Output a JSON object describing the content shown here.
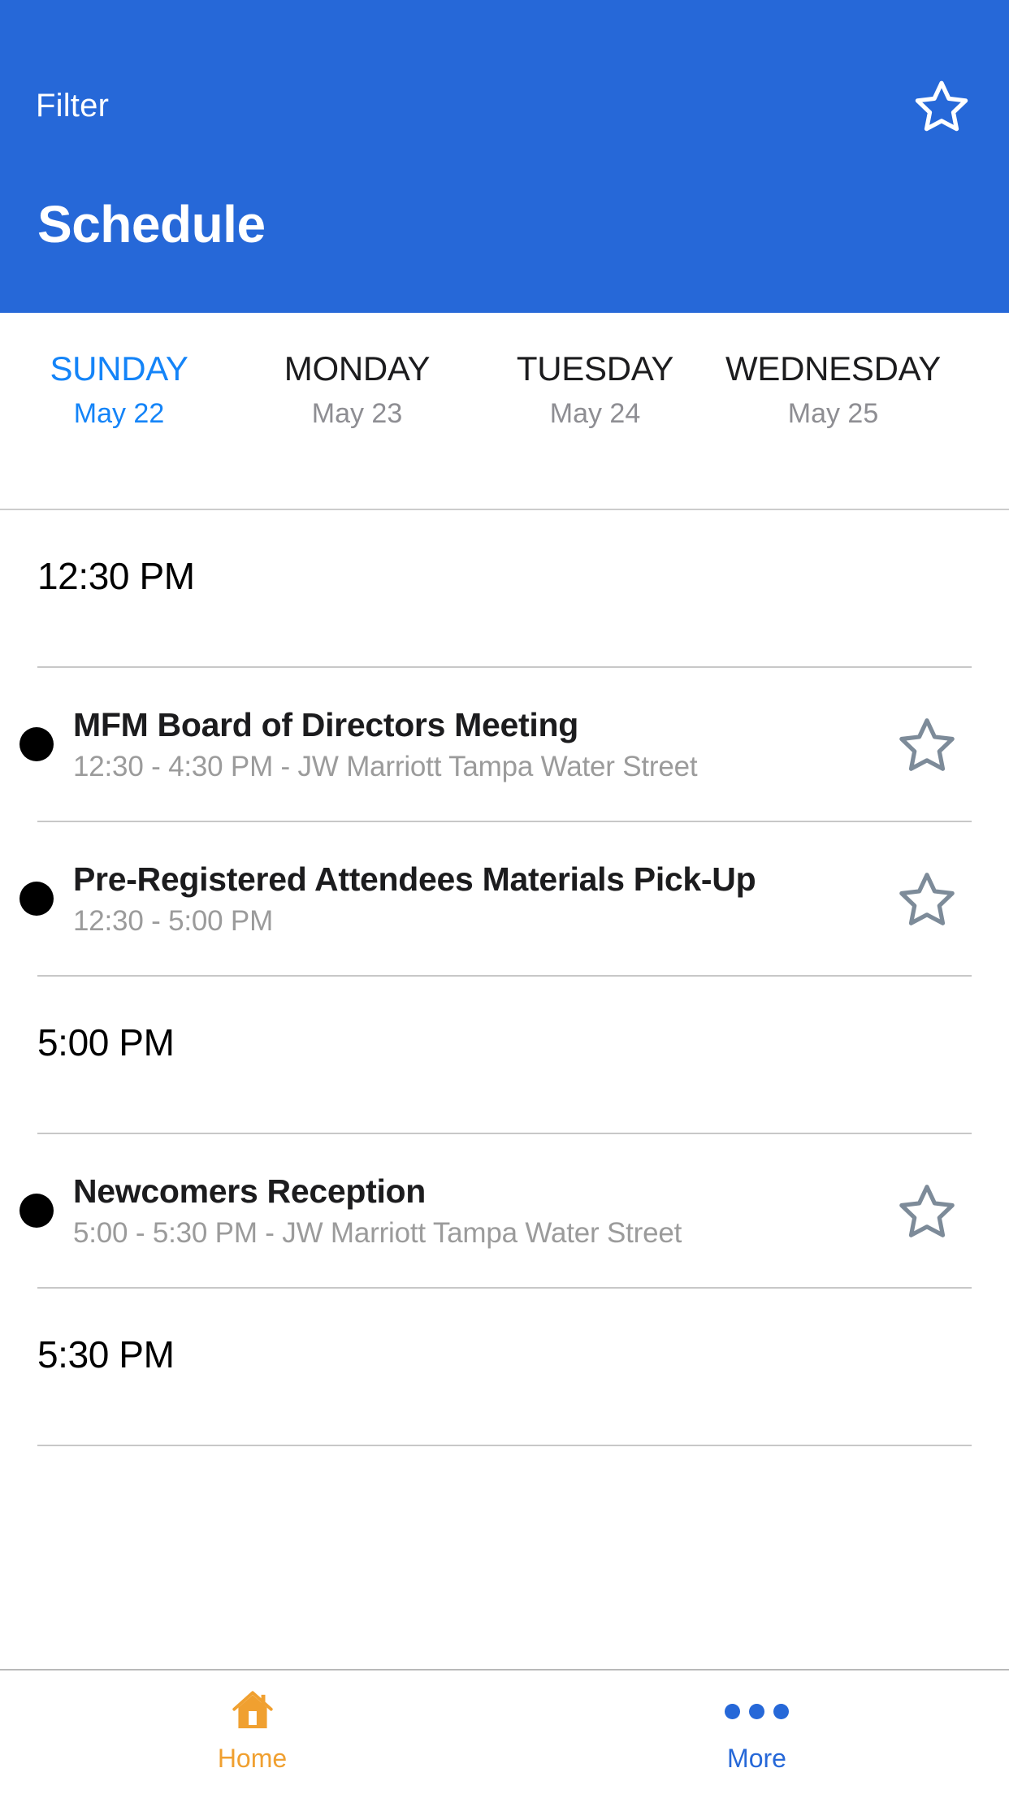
{
  "header": {
    "filter_label": "Filter",
    "title": "Schedule",
    "favorite_icon": "star-outline-icon",
    "background_color": "#2668D8"
  },
  "day_tabs": {
    "active_index": 0,
    "active_color": "#1484F8",
    "items": [
      {
        "day": "SUNDAY",
        "date": "May 22"
      },
      {
        "day": "MONDAY",
        "date": "May 23"
      },
      {
        "day": "TUESDAY",
        "date": "May 24"
      },
      {
        "day": "WEDNESDAY",
        "date": "May 25"
      }
    ]
  },
  "schedule": {
    "groups": [
      {
        "time": "12:30 PM",
        "events": [
          {
            "title": "MFM Board of Directors Meeting",
            "subtitle": "12:30 - 4:30 PM - JW Marriott Tampa Water Street",
            "favorite_icon": "star-outline-icon",
            "favorited": false
          },
          {
            "title": "Pre-Registered Attendees Materials Pick-Up",
            "subtitle": "12:30 - 5:00 PM",
            "favorite_icon": "star-outline-icon",
            "favorited": false
          }
        ]
      },
      {
        "time": "5:00 PM",
        "events": [
          {
            "title": "Newcomers Reception",
            "subtitle": "5:00 - 5:30 PM - JW Marriott Tampa Water Street",
            "favorite_icon": "star-outline-icon",
            "favorited": false
          }
        ]
      },
      {
        "time": "5:30 PM",
        "events": []
      }
    ]
  },
  "bottom_nav": {
    "items": [
      {
        "label": "Home",
        "icon": "home-icon",
        "color": "#F0A030",
        "active": true
      },
      {
        "label": "More",
        "icon": "ellipsis-icon",
        "color": "#2668D8",
        "active": false
      }
    ]
  }
}
